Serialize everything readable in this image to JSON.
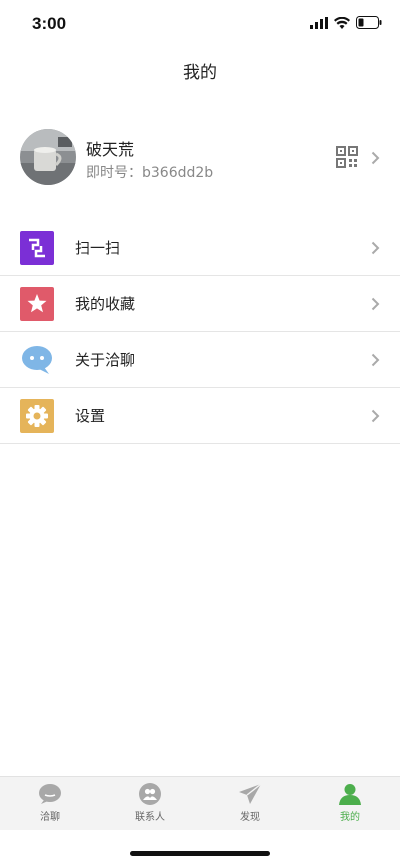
{
  "status": {
    "time": "3:00"
  },
  "header": {
    "title": "我的"
  },
  "profile": {
    "name": "破天荒",
    "id_label": "即时号：b366dd2b"
  },
  "menu": [
    {
      "label": "扫一扫",
      "icon": "scan-icon",
      "color": "#8a2be2"
    },
    {
      "label": "我的收藏",
      "icon": "star-icon",
      "color": "#e05a6a"
    },
    {
      "label": "关于洽聊",
      "icon": "chat-bubble-icon",
      "color": "#7fb6e6"
    },
    {
      "label": "设置",
      "icon": "gear-icon",
      "color": "#e5b45a"
    }
  ],
  "tabbar": {
    "tabs": [
      {
        "label": "洽聊",
        "icon": "chat-icon",
        "active": false
      },
      {
        "label": "联系人",
        "icon": "contacts-icon",
        "active": false
      },
      {
        "label": "发现",
        "icon": "send-icon",
        "active": false
      },
      {
        "label": "我的",
        "icon": "person-icon",
        "active": true
      }
    ]
  },
  "colors": {
    "active": "#4cae4c",
    "inactive": "#9a9a9a"
  }
}
